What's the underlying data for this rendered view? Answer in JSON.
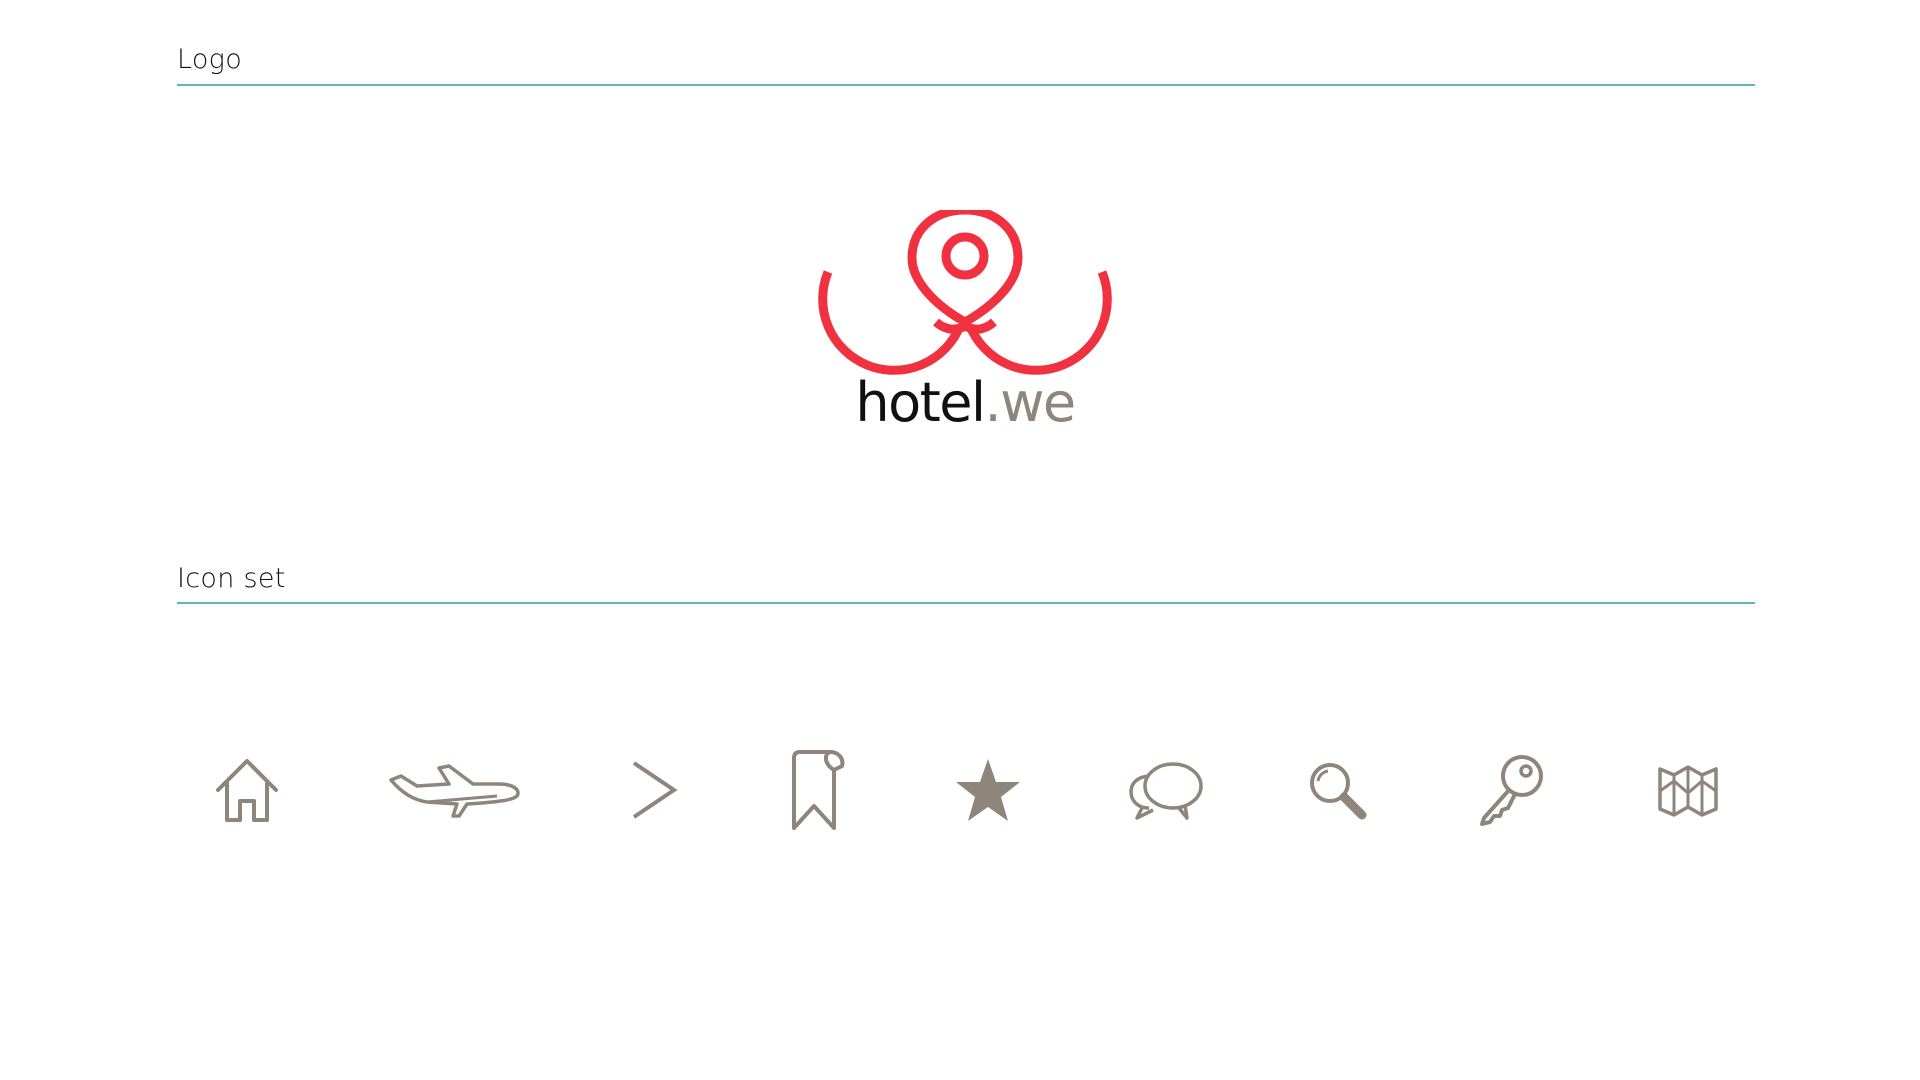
{
  "sections": {
    "logo_title": "Logo",
    "icons_title": "Icon set"
  },
  "logo": {
    "wordmark_part1": "hotel",
    "wordmark_part2": ".we",
    "mark_color": "#f0313f",
    "wordmark_color": "#111111",
    "accent_color": "#8e857b"
  },
  "colors": {
    "rule": "#5db7b8",
    "icon": "#8e857b"
  },
  "icons": [
    "home-icon",
    "airplane-icon",
    "chevron-right-icon",
    "bookmark-icon",
    "star-icon",
    "chat-bubbles-icon",
    "search-icon",
    "key-icon",
    "map-icon"
  ]
}
